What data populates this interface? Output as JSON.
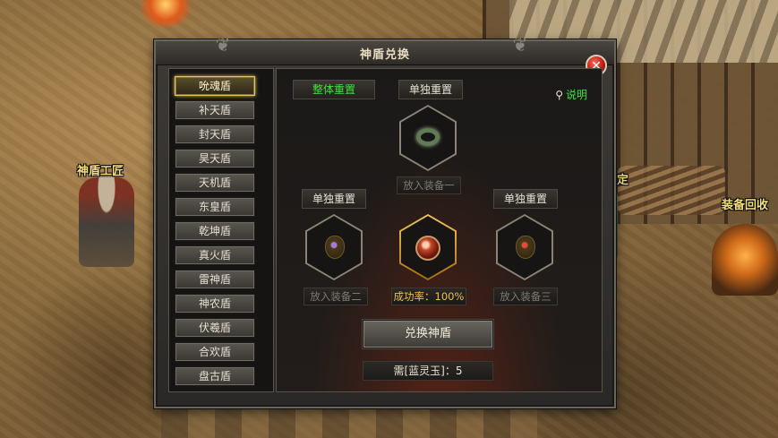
{
  "scene": {
    "npc_left_label": "神盾工匠",
    "npc_right_label_partial": "鉴定",
    "npc_far_right_label": "装备回收"
  },
  "dialog": {
    "title": "神盾兑换",
    "close_icon": "close-icon",
    "shields": [
      "吮魂盾",
      "补天盾",
      "封天盾",
      "昊天盾",
      "天机盾",
      "东皇盾",
      "乾坤盾",
      "真火盾",
      "雷神盾",
      "神农盾",
      "伏羲盾",
      "合欢盾",
      "盘古盾"
    ],
    "selected_index": 0,
    "reset_all_label": "整体重置",
    "reset_single_label": "单独重置",
    "help_label": "说明",
    "slot1_label": "放入装备一",
    "slot2_label": "放入装备二",
    "slot3_label": "放入装备三",
    "success_rate_label": "成功率：100%",
    "exchange_label": "兑换神盾",
    "cost_label": "需[蓝灵玉]：5",
    "colors": {
      "accent_green": "#3ee23e",
      "gold": "#f0c040",
      "close_red": "#b3160e"
    }
  }
}
